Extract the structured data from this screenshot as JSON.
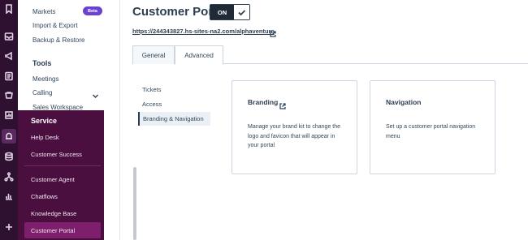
{
  "sidebar": {
    "markets_label": "Markets",
    "beta_badge": "Beta",
    "import_export": "Import & Export",
    "backup_restore": "Backup & Restore",
    "tools_heading": "Tools",
    "meetings": "Meetings",
    "calling": "Calling",
    "sales_workspace": "Sales Workspace"
  },
  "flyout": {
    "title": "Service",
    "items": [
      {
        "label": "Help Desk"
      },
      {
        "label": "Customer Success"
      },
      {
        "label": "Customer Agent"
      },
      {
        "label": "Chatflows"
      },
      {
        "label": "Knowledge Base"
      },
      {
        "label": "Customer Portal"
      }
    ],
    "selected": "Customer Portal"
  },
  "header": {
    "title": "Customer Portal",
    "toggle_label": "ON",
    "portal_url": "https://244343827.hs-sites-na2.com/alphaventure"
  },
  "tabs": [
    {
      "label": "General"
    },
    {
      "label": "Advanced"
    }
  ],
  "active_tab": "Advanced",
  "subnav": [
    {
      "label": "Tickets"
    },
    {
      "label": "Access"
    },
    {
      "label": "Branding & Navigation"
    }
  ],
  "active_subnav": "Branding & Navigation",
  "cards": [
    {
      "title": "Branding",
      "description": "Manage your brand kit to change the logo and favicon that will appear in your portal"
    },
    {
      "title": "Navigation",
      "description": "Set up a customer portal navigation menu"
    }
  ],
  "colors": {
    "rail": "#2e1031",
    "flyout": "#4a0f3f",
    "flyout_selected": "#7d1f6c",
    "beta_badge": "#6a42d1",
    "text": "#33475b"
  },
  "icons": {
    "rail": [
      "bookmark-icon",
      "inbox-icon",
      "megaphone-icon",
      "contacts-icon",
      "commerce-icon",
      "reports-icon",
      "service-icon",
      "database-icon",
      "workflow-icon",
      "analytics-icon",
      "add-icon",
      "settings-icon"
    ]
  }
}
